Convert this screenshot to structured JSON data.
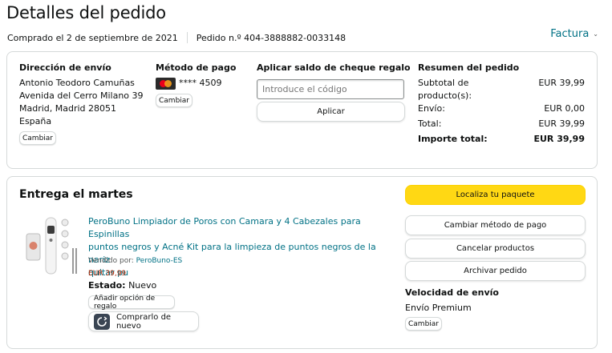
{
  "header": {
    "title": "Detalles del pedido",
    "order_date": "Comprado el 2 de septiembre de 2021",
    "order_number": "Pedido n.º 404-3888882-0033148",
    "invoice_label": "Factura"
  },
  "shipping_address": {
    "heading": "Dirección de envío",
    "lines": [
      "Antonio Teodoro Camuñas",
      "Avenida del Cerro Milano 39",
      "Madrid, Madrid 28051",
      "España"
    ],
    "change_label": "Cambiar"
  },
  "payment": {
    "heading": "Método de pago",
    "card_masked": "**** 4509",
    "change_label": "Cambiar"
  },
  "gift_card": {
    "heading": "Aplicar saldo de cheque regalo",
    "placeholder": "Introduce el código",
    "apply_label": "Aplicar"
  },
  "summary": {
    "heading": "Resumen del pedido",
    "rows": [
      {
        "label": "Subtotal de producto(s):",
        "value": "EUR 39,99"
      },
      {
        "label": "Envío:",
        "value": "EUR 0,00"
      },
      {
        "label": "Total:",
        "value": "EUR 39,99"
      },
      {
        "label": "Importe total:",
        "value": "EUR 39,99"
      }
    ]
  },
  "delivery": {
    "heading": "Entrega el martes",
    "product": {
      "title_lines": [
        "PeroBuno Limpiador de Poros con Camara y 4 Cabezales para Espinillas",
        "puntos negros y Acné Kit para la limpieza de puntos negros de la nariz",
        "quitar pu"
      ],
      "seller_label": "Vendido por:",
      "seller_name": "PeroBuno-ES",
      "price": "EUR 39,99",
      "state_label": "Estado:",
      "state_value": "Nuevo",
      "gift_label": "Añadir opción de regalo",
      "rebuy_label": "Comprarlo de nuevo"
    },
    "actions": {
      "track": "Localiza tu paquete",
      "change_payment": "Cambiar método de pago",
      "cancel": "Cancelar productos",
      "archive": "Archivar pedido"
    },
    "speed": {
      "heading": "Velocidad de envío",
      "value": "Envío Premium",
      "change_label": "Cambiar"
    }
  },
  "colors": {
    "link": "#007185",
    "price": "#b12704",
    "primary_button": "#ffd814",
    "border": "#d5d9d9"
  }
}
